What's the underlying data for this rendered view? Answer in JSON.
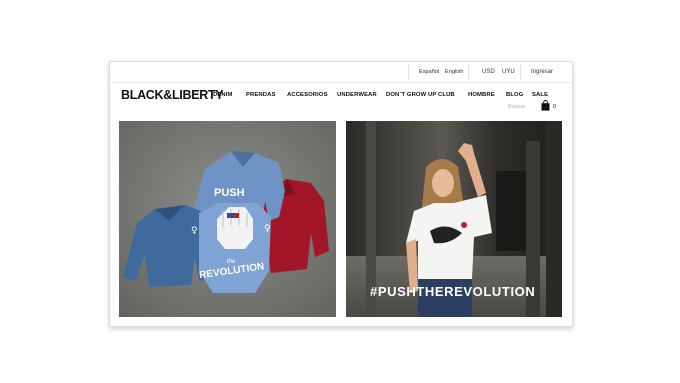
{
  "topbar": {
    "lang_es": "Español",
    "lang_en": "English",
    "currency_usd": "USD",
    "currency_uyu": "UYU",
    "login": "Ingresar"
  },
  "brand": {
    "logo": "BLACK&LIBERTY"
  },
  "nav": {
    "items": [
      "DENIM",
      "PRENDAS",
      "ACCESORIOS",
      "UNDERWEAR",
      "DON´T GROW UP CLUB",
      "HOMBRE",
      "BLOG",
      "SALE"
    ]
  },
  "search": {
    "placeholder": "Buscar"
  },
  "cart": {
    "count": "0",
    "icon": "shopping-bag-icon"
  },
  "hero_left": {
    "image": "jackets-flatlay-photo",
    "print_top": "PUSH",
    "print_middle": "the",
    "print_bottom": "REVOLUTION"
  },
  "hero_right": {
    "image": "model-raised-fist-photo",
    "caption": "#PUSHTHEREVOLUTION"
  },
  "colors": {
    "accent": "#111111",
    "denim": "#5b7fb0",
    "red": "#a3162a"
  }
}
